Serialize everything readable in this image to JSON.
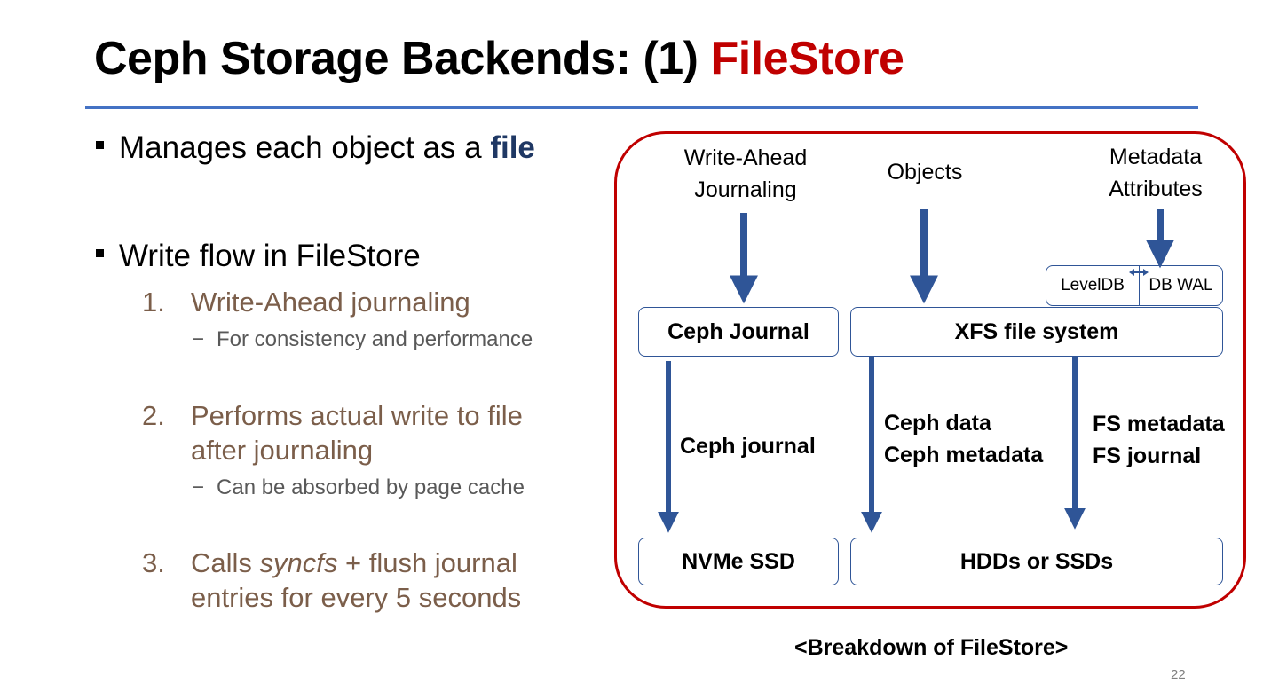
{
  "slide": {
    "title_prefix": "Ceph Storage Backends: (1) ",
    "title_highlight": "FileStore",
    "page_number": "22"
  },
  "bullets": {
    "b1_prefix": "Manages each object as a ",
    "b1_highlight": "file",
    "b2": "Write flow in FileStore",
    "items": [
      {
        "num": "1.",
        "line1": "Write-Ahead journaling",
        "sub": "For consistency and performance"
      },
      {
        "num": "2.",
        "line1": "Performs actual write to file",
        "line2": "after journaling",
        "sub": "Can be absorbed by page cache"
      },
      {
        "num": "3.",
        "line1_pre": "Calls ",
        "line1_em": "syncfs",
        "line1_post": " + flush journal",
        "line2": "entries for every 5 seconds"
      }
    ],
    "dash": "−"
  },
  "diagram": {
    "top_labels": {
      "wal_line1": "Write-Ahead",
      "wal_line2": "Journaling",
      "objects": "Objects",
      "meta_line1": "Metadata",
      "meta_line2": "Attributes"
    },
    "leveldb": "LevelDB",
    "db_wal": "DB WAL",
    "ceph_journal_box": "Ceph Journal",
    "xfs_box": "XFS file system",
    "ceph_journal_label": "Ceph journal",
    "ceph_data_line1": "Ceph data",
    "ceph_data_line2": "Ceph metadata",
    "fs_meta_line1": "FS metadata",
    "fs_meta_line2": "FS journal",
    "nvme_box": "NVMe SSD",
    "hdd_box": "HDDs or SSDs",
    "caption": "<Breakdown of FileStore>"
  },
  "colors": {
    "accent_red": "#c00000",
    "rule_blue": "#4472c4",
    "arrow_blue": "#2f5597",
    "highlight_navy": "#1f3864",
    "numbered_brown": "#7b5e4a",
    "sub_gray": "#595959"
  },
  "icons": [
    "bullet-square-icon",
    "down-arrow-icon",
    "double-arrow-icon"
  ]
}
